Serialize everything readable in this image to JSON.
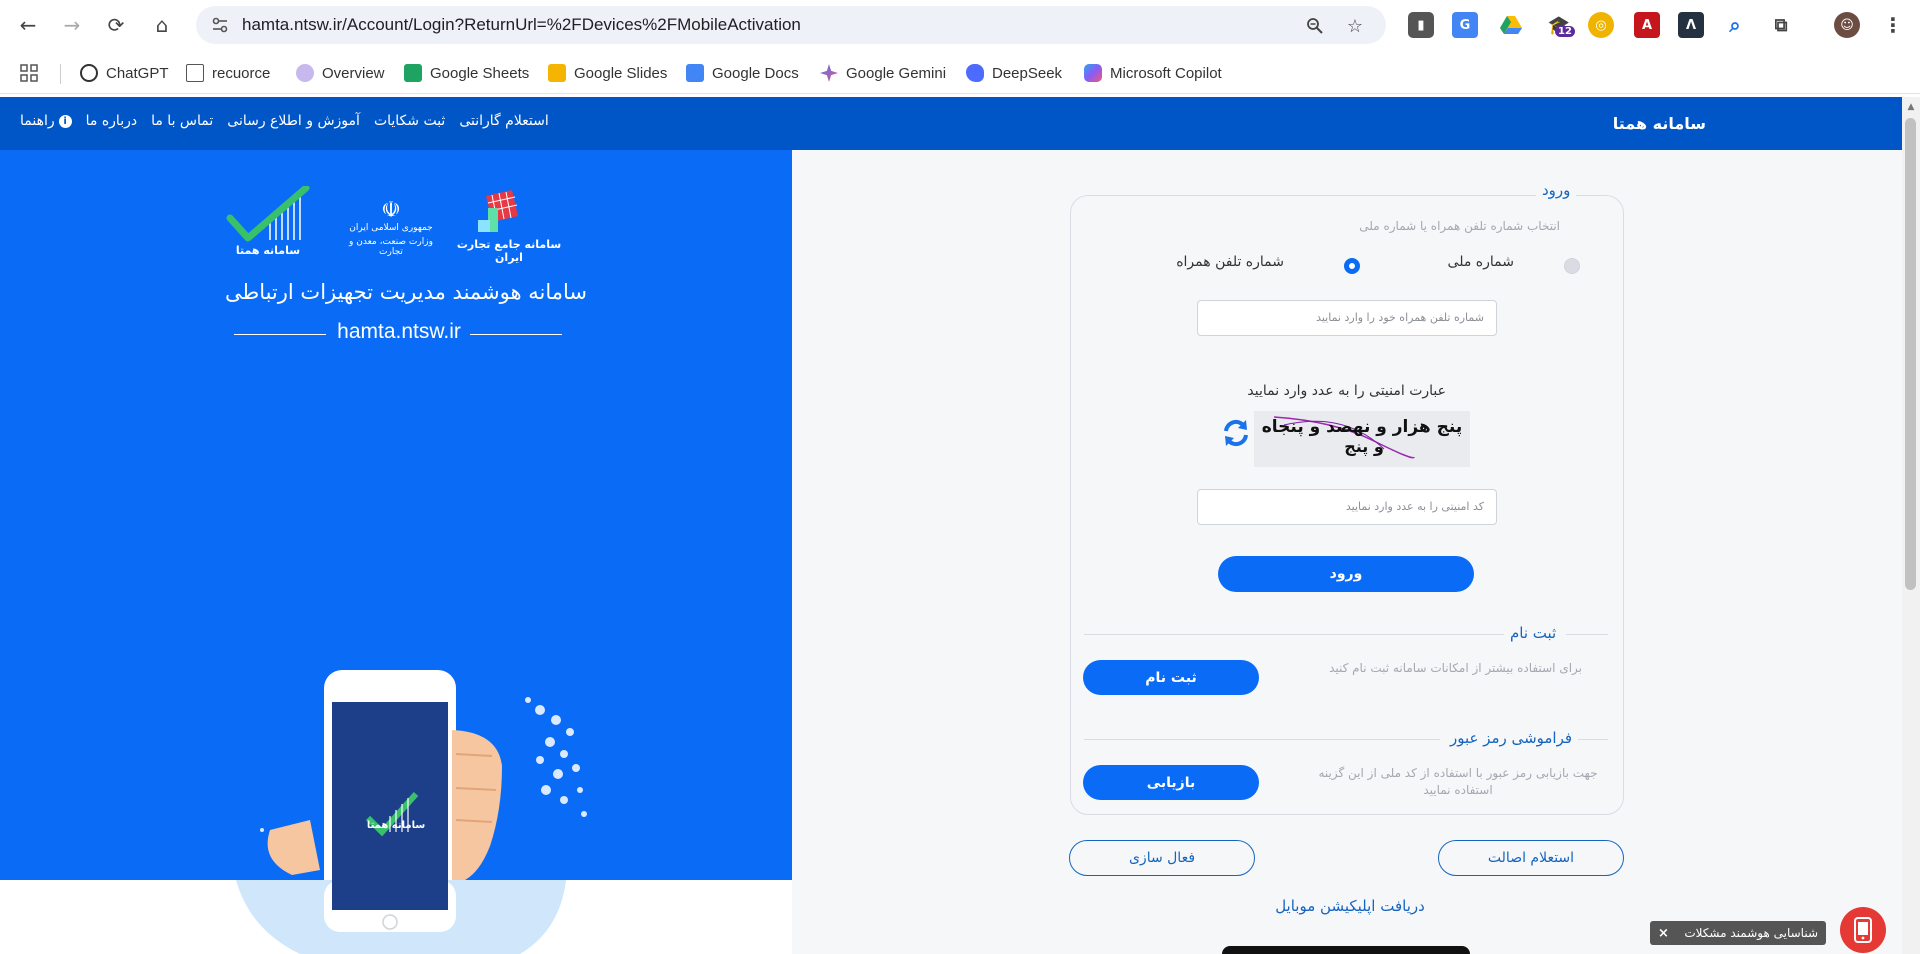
{
  "browser": {
    "url": "hamta.ntsw.ir/Account/Login?ReturnUrl=%2FDevices%2FMobileActivation",
    "extension_badge": "12",
    "bookmarks": [
      {
        "label": "ChatGPT",
        "color": "#333333"
      },
      {
        "label": "recuorce",
        "color": "#555555"
      },
      {
        "label": "Overview",
        "color": "#8a6cd6"
      },
      {
        "label": "Google Sheets",
        "color": "#1ea362"
      },
      {
        "label": "Google Slides",
        "color": "#f4b400"
      },
      {
        "label": "Google Docs",
        "color": "#4285f4"
      },
      {
        "label": "Google Gemini",
        "color": "#4b7bec"
      },
      {
        "label": "DeepSeek",
        "color": "#4d6bfe"
      },
      {
        "label": "Microsoft Copilot",
        "color": "#e5518a"
      }
    ]
  },
  "topbar": {
    "brand": "سامانه همتا",
    "menu": [
      "استعلام گارانتی",
      "ثبت شکایات",
      "آموزش و اطلاع رسانی",
      "تماس با ما",
      "درباره ما",
      "راهنما"
    ]
  },
  "hero": {
    "title": "سامانه هوشمند مدیریت تجهیزات ارتباطی",
    "domain": "hamta.ntsw.ir",
    "logos": {
      "ntsw": "سامانه جامع تجارت ایران",
      "ministry_line1": "جمهوری اسلامی ایران",
      "ministry_line2": "وزارت صنعت، معدن و تجارت",
      "hamta": "سامانه همتا"
    },
    "phone_logo": "سامانه همتا"
  },
  "login": {
    "legend": "ورود",
    "hint": "انتخاب شماره تلفن همراه یا شماره ملی",
    "option_national": "شماره ملی",
    "option_mobile": "شماره تلفن همراه",
    "phone_placeholder": "شماره تلفن همراه خود را وارد نمایید",
    "captcha_label": "عبارت امنیتی را به عدد وارد نمایید",
    "captcha_text_1": "پنج هزار و نهصد و پنجاه",
    "captcha_text_2": "و پنج",
    "captcha_placeholder": "کد امنیتی را به عدد وارد نمایید",
    "submit": "ورود"
  },
  "register": {
    "legend": "ثبت نام",
    "hint": "برای استفاده بیشتر از امکانات سامانه ثبت نام کنید",
    "button": "ثبت نام"
  },
  "forgot": {
    "legend": "فراموشی رمز عبور",
    "hint": "جهت بازیابی رمز عبور با استفاده از کد ملی از این گزینه استفاده نمایید",
    "button": "بازیابی"
  },
  "actions": {
    "authenticity": "استعلام اصالت",
    "activation": "فعال سازی",
    "download_app": "دریافت اپلیکیشن موبایل"
  },
  "toast": {
    "label": "شناسایی هوشمند مشکلات",
    "close": "×"
  }
}
